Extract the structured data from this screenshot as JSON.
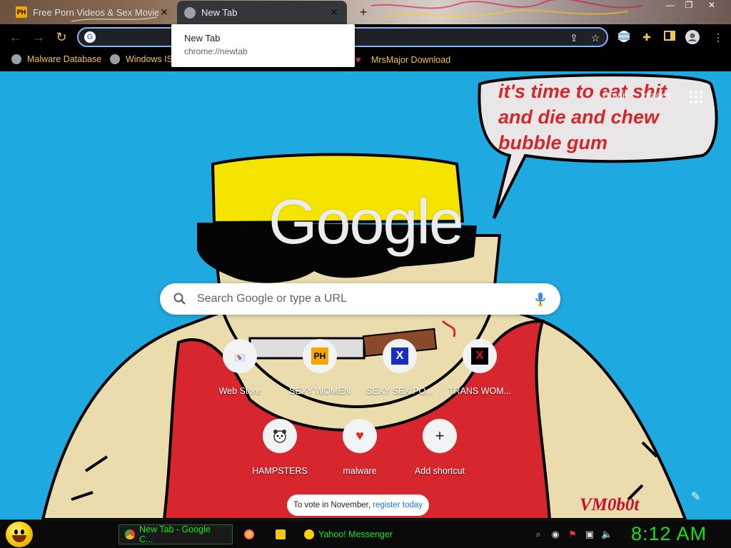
{
  "browser": {
    "tabs": [
      {
        "title": "Free Porn Videos & Sex Movies",
        "favicon": "ph-icon",
        "active": false
      },
      {
        "title": "New Tab",
        "favicon": "globe-icon",
        "active": true
      }
    ],
    "hover_card": {
      "title": "New Tab",
      "url": "chrome://newtab"
    },
    "window_controls": [
      "—",
      "❐",
      "✕"
    ],
    "omnibox": {
      "value": "",
      "placeholder": ""
    },
    "bookmarks": [
      {
        "label": "Malware Database",
        "icon": "globe-icon"
      },
      {
        "label": "Windows IS",
        "icon": "globe-icon"
      },
      {
        "label": "MrsMajor Download",
        "icon": "heart-icon"
      }
    ]
  },
  "newtab": {
    "top_links": {
      "gmail": "Gmail",
      "images": "Images"
    },
    "speech_bubble": "it's time to eat shit and die and chew bubble gum",
    "logo": "Google",
    "search": {
      "placeholder": "Search Google or type a URL"
    },
    "shortcuts": [
      {
        "label": "Web Store",
        "icon": "chrome-webstore-icon"
      },
      {
        "label": "SEXY WOMEN",
        "icon": "ph-icon"
      },
      {
        "label": "SEXY SEX PO...",
        "icon": "x-blue-icon"
      },
      {
        "label": "TRANS WOM...",
        "icon": "x-red-icon"
      },
      {
        "label": "HAMPSTERS",
        "icon": "hamster-icon"
      },
      {
        "label": "malware",
        "icon": "heart-icon"
      },
      {
        "label": "Add shortcut",
        "icon": "plus-icon"
      }
    ],
    "vote_banner": {
      "text": "To vote in November, ",
      "link": "register today"
    },
    "signature": "VM0b0t"
  },
  "taskbar": {
    "tasks": [
      {
        "label": "New Tab - Google C...",
        "icon": "chrome-icon"
      },
      {
        "label": "",
        "icon": "firefox-icon"
      },
      {
        "label": "",
        "icon": "folder-icon"
      },
      {
        "label": "Yahoo! Messenger",
        "icon": "smiley-icon"
      }
    ],
    "clock": "8:12 AM"
  },
  "colors": {
    "background": "#1eaae0",
    "bookmark_text": "#f1c44b",
    "taskbar_text": "#14e620",
    "bubble_text": "#d6262a"
  }
}
